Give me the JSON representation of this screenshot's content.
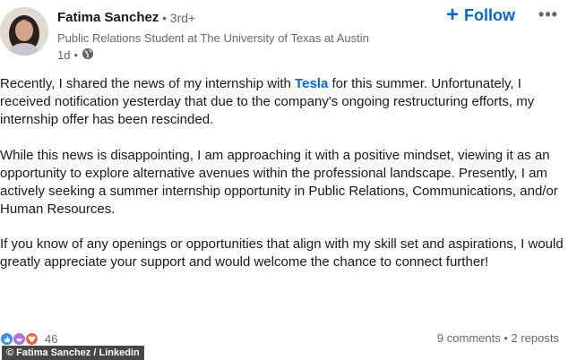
{
  "post": {
    "author": {
      "name": "Fatima Sanchez",
      "degree": "• 3rd+",
      "headline": "Public Relations Student at The University of Texas at Austin",
      "time": "1d",
      "separator": "•"
    },
    "follow_label": "Follow",
    "follow_plus": "+",
    "more_label": "•••",
    "body": {
      "p1_before": "Recently, I shared the news of my internship with ",
      "p1_mention": "Tesla",
      "p1_after": " for this summer. Unfortunately, I received notification yesterday that due to the company's ongoing restructuring efforts, my internship offer has been rescinded.",
      "p2": "While this news is disappointing, I am approaching it with a positive mindset, viewing it as an opportunity to explore alternative avenues within the professional landscape. Presently, I am actively seeking a summer internship opportunity in Public Relations, Communications, and/or Human Resources.",
      "p3": "If you know of any openings or opportunities that align with my skill set and aspirations, I would greatly appreciate your support and would welcome the chance to connect further!"
    },
    "reactions": {
      "count": "46",
      "icons": [
        "like-icon",
        "support-icon",
        "love-icon"
      ],
      "colors": {
        "like": "#378fe9",
        "support": "#a872e8",
        "love": "#e06b43"
      }
    },
    "comments": "9 comments",
    "stats_separator": " • ",
    "reposts": "2 reposts"
  },
  "credit": "© Fatima Sanchez / Linkedin",
  "colors": {
    "accent": "#0a66c2"
  }
}
